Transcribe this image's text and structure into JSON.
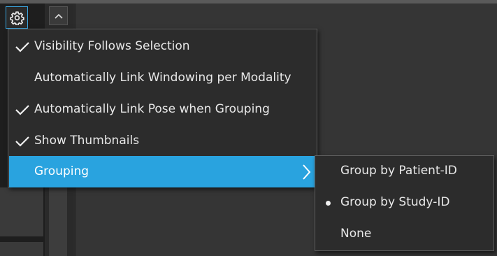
{
  "toolbar": {
    "settings_icon": "gear-icon",
    "collapse_icon": "chevron-up-icon"
  },
  "colors": {
    "accent": "#29a3df",
    "menu_bg": "#2c2c2c",
    "background": "#353535"
  },
  "menu": {
    "items": [
      {
        "label": "Visibility Follows Selection",
        "checked": true
      },
      {
        "label": "Automatically Link Windowing per Modality",
        "checked": false
      },
      {
        "label": "Automatically Link Pose when Grouping",
        "checked": true
      },
      {
        "label": "Show Thumbnails",
        "checked": true
      },
      {
        "label": "Grouping",
        "has_submenu": true,
        "highlighted": true
      }
    ]
  },
  "submenu": {
    "items": [
      {
        "label": "Group by Patient-ID",
        "selected": false
      },
      {
        "label": "Group by Study-ID",
        "selected": true
      },
      {
        "label": "None",
        "selected": false
      }
    ]
  }
}
